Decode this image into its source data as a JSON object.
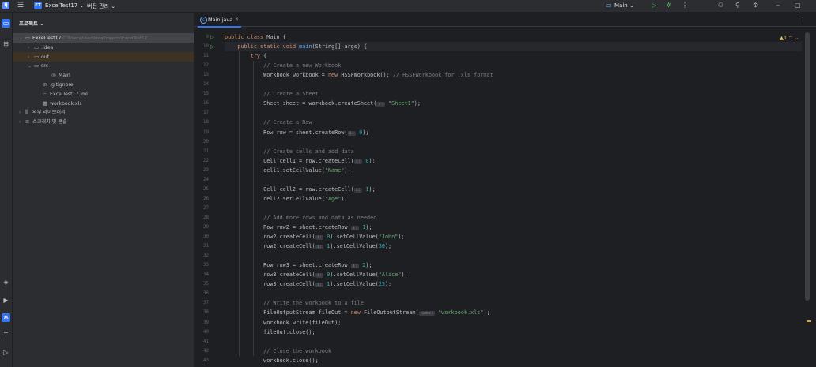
{
  "titlebar": {
    "logo": "IJ",
    "project_badge": "ET",
    "project_name": "ExcelTest17",
    "vcs_label": "버전 관리",
    "run_config": "Main",
    "chevron": "⌄"
  },
  "project_panel": {
    "title": "프로젝트",
    "tree": [
      {
        "label": "ExcelTest17",
        "path": "C:\\Users\\User\\IdeaProjects\\ExcelTest17",
        "chev": "⌄",
        "icon": "▭",
        "indent": 0,
        "state": "sel"
      },
      {
        "label": ".idea",
        "path": "",
        "chev": "›",
        "icon": "▭",
        "indent": 1,
        "state": ""
      },
      {
        "label": "out",
        "path": "",
        "chev": "›",
        "icon": "▭",
        "indent": 1,
        "state": "out"
      },
      {
        "label": "src",
        "path": "",
        "chev": "⌄",
        "icon": "▭",
        "indent": 1,
        "state": ""
      },
      {
        "label": "Main",
        "path": "",
        "chev": "",
        "icon": "◎",
        "indent": 3,
        "state": ""
      },
      {
        "label": ".gitignore",
        "path": "",
        "chev": "",
        "icon": "⊘",
        "indent": 2,
        "state": ""
      },
      {
        "label": "ExcelTest17.iml",
        "path": "",
        "chev": "",
        "icon": "▭",
        "indent": 2,
        "state": ""
      },
      {
        "label": "workbook.xls",
        "path": "",
        "chev": "",
        "icon": "▦",
        "indent": 2,
        "state": ""
      },
      {
        "label": "외부 라이브러리",
        "path": "",
        "chev": "›",
        "icon": "⫼",
        "indent": 0,
        "state": ""
      },
      {
        "label": "스크래치 및 콘솔",
        "path": "",
        "chev": "›",
        "icon": "≡",
        "indent": 0,
        "state": ""
      }
    ]
  },
  "editor": {
    "tab_label": "Main.java",
    "tab_icon": "c",
    "warnings": "▲1 ^ ⌄",
    "lines": [
      {
        "n": "9",
        "run": true,
        "html": "<span class='kw'>public class</span> Main {"
      },
      {
        "n": "10",
        "run": true,
        "html": "    <span class='kw'>public static void</span> <span class='fn'>main</span>(String[] args) {"
      },
      {
        "n": "11",
        "run": false,
        "html": "        <span class='kw'>try</span> {"
      },
      {
        "n": "12",
        "run": false,
        "html": "            <span class='cm'>// Create a new Workbook</span>"
      },
      {
        "n": "13",
        "run": false,
        "html": "            Workbook workbook = <span class='kw'>new</span> HSSFWorkbook(); <span class='cm'>// HSSFWorkbook for .xls format</span>"
      },
      {
        "n": "14",
        "run": false,
        "html": ""
      },
      {
        "n": "15",
        "run": false,
        "html": "            <span class='cm'>// Create a Sheet</span>"
      },
      {
        "n": "16",
        "run": false,
        "html": "            Sheet sheet = workbook.createSheet(<span class='hint'>s:</span> <span class='st'>\"Sheet1\"</span>);"
      },
      {
        "n": "17",
        "run": false,
        "html": ""
      },
      {
        "n": "18",
        "run": false,
        "html": "            <span class='cm'>// Create a Row</span>"
      },
      {
        "n": "19",
        "run": false,
        "html": "            Row row = sheet.createRow(<span class='hint'>i:</span> <span class='nm'>0</span>);"
      },
      {
        "n": "20",
        "run": false,
        "html": ""
      },
      {
        "n": "21",
        "run": false,
        "html": "            <span class='cm'>// Create cells and add data</span>"
      },
      {
        "n": "22",
        "run": false,
        "html": "            Cell cell1 = row.createCell(<span class='hint'>i:</span> <span class='nm'>0</span>);"
      },
      {
        "n": "23",
        "run": false,
        "html": "            cell1.setCellValue(<span class='st'>\"Name\"</span>);"
      },
      {
        "n": "24",
        "run": false,
        "html": ""
      },
      {
        "n": "25",
        "run": false,
        "html": "            Cell cell2 = row.createCell(<span class='hint'>i:</span> <span class='nm'>1</span>);"
      },
      {
        "n": "26",
        "run": false,
        "html": "            cell2.setCellValue(<span class='st'>\"Age\"</span>);"
      },
      {
        "n": "27",
        "run": false,
        "html": ""
      },
      {
        "n": "28",
        "run": false,
        "html": "            <span class='cm'>// Add more rows and data as needed</span>"
      },
      {
        "n": "29",
        "run": false,
        "html": "            Row row2 = sheet.createRow(<span class='hint'>i:</span> <span class='nm'>1</span>);"
      },
      {
        "n": "30",
        "run": false,
        "html": "            row2.createCell(<span class='hint'>i:</span> <span class='nm'>0</span>).setCellValue(<span class='st'>\"John\"</span>);"
      },
      {
        "n": "31",
        "run": false,
        "html": "            row2.createCell(<span class='hint'>i:</span> <span class='nm'>1</span>).setCellValue(<span class='nm'>30</span>);"
      },
      {
        "n": "32",
        "run": false,
        "html": ""
      },
      {
        "n": "33",
        "run": false,
        "html": "            Row row3 = sheet.createRow(<span class='hint'>i:</span> <span class='nm'>2</span>);"
      },
      {
        "n": "34",
        "run": false,
        "html": "            row3.createCell(<span class='hint'>i:</span> <span class='nm'>0</span>).setCellValue(<span class='st'>\"Alice\"</span>);"
      },
      {
        "n": "35",
        "run": false,
        "html": "            row3.createCell(<span class='hint'>i:</span> <span class='nm'>1</span>).setCellValue(<span class='nm'>25</span>);"
      },
      {
        "n": "36",
        "run": false,
        "html": ""
      },
      {
        "n": "37",
        "run": false,
        "html": "            <span class='cm'>// Write the workbook to a file</span>"
      },
      {
        "n": "38",
        "run": false,
        "html": "            FileOutputStream fileOut = <span class='kw'>new</span> FileOutputStream(<span class='hint'>name:</span> <span class='st'>\"workbook.xls\"</span>);"
      },
      {
        "n": "39",
        "run": false,
        "html": "            workbook.write(fileOut);"
      },
      {
        "n": "40",
        "run": false,
        "html": "            fileOut.close();"
      },
      {
        "n": "41",
        "run": false,
        "html": ""
      },
      {
        "n": "42",
        "run": false,
        "html": "            <span class='cm'>// Close the workbook</span>"
      },
      {
        "n": "43",
        "run": false,
        "html": "            workbook.close();"
      }
    ]
  }
}
